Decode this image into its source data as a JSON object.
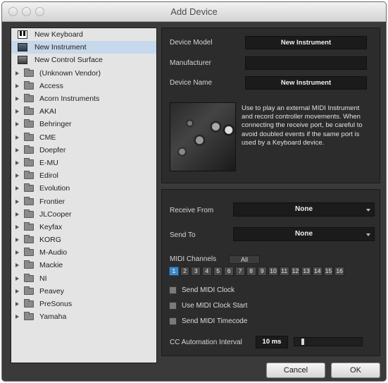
{
  "window": {
    "title": "Add Device"
  },
  "device_list": {
    "top_items": [
      {
        "label": "New Keyboard",
        "icon": "keyboard-icon",
        "selected": false
      },
      {
        "label": "New Instrument",
        "icon": "instrument-icon",
        "selected": true
      },
      {
        "label": "New Control Surface",
        "icon": "control-surface-icon",
        "selected": false
      }
    ],
    "vendors": [
      "(Unknown Vendor)",
      "Access",
      "Acorn Instruments",
      "AKAI",
      "Behringer",
      "CME",
      "Doepfer",
      "E-MU",
      "Edirol",
      "Evolution",
      "Frontier",
      "JLCooper",
      "Keyfax",
      "KORG",
      "M-Audio",
      "Mackie",
      "NI",
      "Peavey",
      "PreSonus",
      "Yamaha"
    ]
  },
  "device_info": {
    "model_label": "Device Model",
    "model_value": "New Instrument",
    "manufacturer_label": "Manufacturer",
    "manufacturer_value": "",
    "name_label": "Device Name",
    "name_value": "New Instrument",
    "description": "Use to play an external MIDI Instrument and record controller movements. When connecting the receive port, be careful to avoid doubled events if the same port is used by a Keyboard device."
  },
  "ports": {
    "receive_label": "Receive From",
    "receive_value": "None",
    "send_label": "Send To",
    "send_value": "None"
  },
  "midi_channels": {
    "label": "MIDI Channels",
    "all_label": "All",
    "channels": [
      "1",
      "2",
      "3",
      "4",
      "5",
      "6",
      "7",
      "8",
      "9",
      "10",
      "11",
      "12",
      "13",
      "14",
      "15",
      "16"
    ],
    "active": [
      "1"
    ]
  },
  "options": {
    "send_clock": "Send MIDI Clock",
    "use_clock_start": "Use MIDI Clock Start",
    "send_timecode": "Send MIDI Timecode"
  },
  "automation": {
    "label": "CC Automation Interval",
    "value": "10 ms"
  },
  "buttons": {
    "cancel": "Cancel",
    "ok": "OK"
  },
  "colors": {
    "channel_active": "#3e89c8",
    "selection": "#c6d8ec"
  }
}
